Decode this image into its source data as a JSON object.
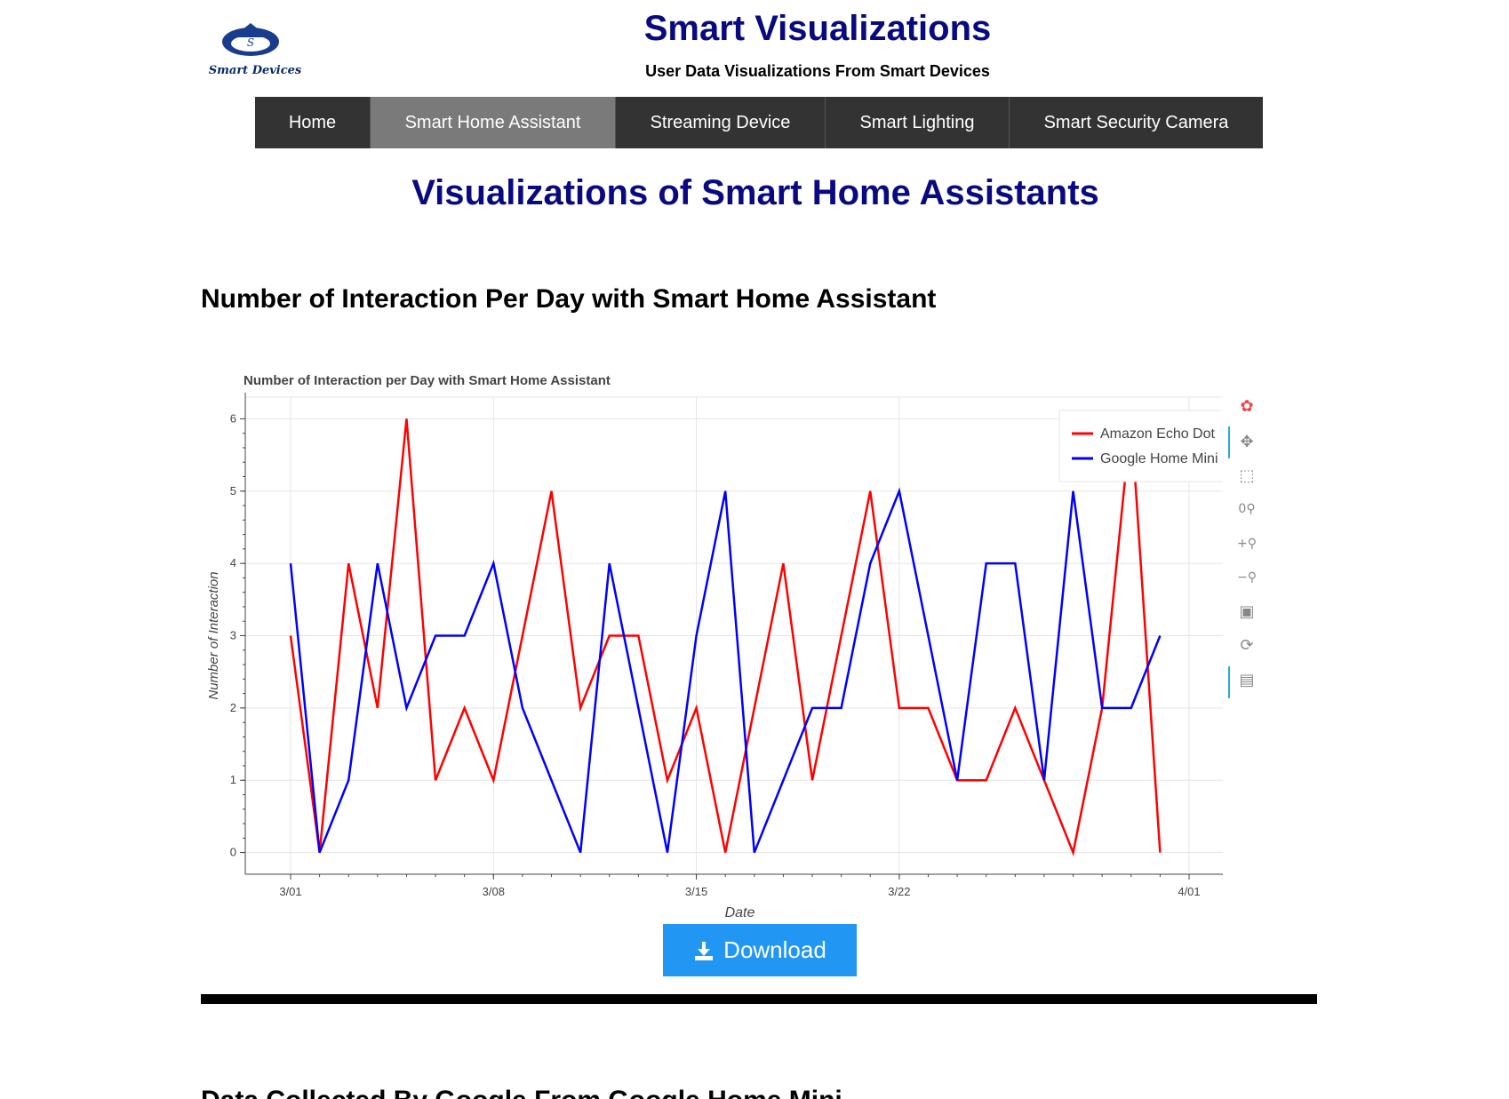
{
  "logo": {
    "text": "Smart Devices"
  },
  "header": {
    "title": "Smart Visualizations",
    "subtitle": "User Data Visualizations From Smart Devices"
  },
  "nav": {
    "items": [
      {
        "label": "Home"
      },
      {
        "label": "Smart Home Assistant"
      },
      {
        "label": "Streaming Device"
      },
      {
        "label": "Smart Lighting"
      },
      {
        "label": "Smart Security Camera"
      }
    ],
    "active": "Smart Home Assistant"
  },
  "page": {
    "heading": "Visualizations of Smart Home Assistants"
  },
  "section1": {
    "heading": "Number of Interaction Per Day with Smart Home Assistant"
  },
  "section2": {
    "heading": "Data Collected By Google From Google Home Mini"
  },
  "download": {
    "label": "Download"
  },
  "toolbar": {
    "icons": [
      "bokeh-logo-icon",
      "pan-icon",
      "box-zoom-icon",
      "wheel-zoom-icon",
      "zoom-in-icon",
      "zoom-out-icon",
      "save-icon",
      "reset-icon",
      "hover-icon"
    ]
  },
  "chart_data": {
    "type": "line",
    "title": "Number of Interaction per Day with Smart Home Assistant",
    "xlabel": "Date",
    "ylabel": "Number of Interaction",
    "x_ticks": [
      "3/01",
      "3/08",
      "3/15",
      "3/22",
      "4/01"
    ],
    "y_ticks": [
      0,
      1,
      2,
      3,
      4,
      5,
      6
    ],
    "ylim": [
      -0.3,
      6.3
    ],
    "grid": true,
    "legend_position": "top-right",
    "x": [
      "3/01",
      "3/02",
      "3/03",
      "3/04",
      "3/05",
      "3/06",
      "3/07",
      "3/08",
      "3/09",
      "3/10",
      "3/11",
      "3/12",
      "3/13",
      "3/14",
      "3/15",
      "3/16",
      "3/17",
      "3/18",
      "3/19",
      "3/20",
      "3/21",
      "3/22",
      "3/23",
      "3/24",
      "3/25",
      "3/26",
      "3/27",
      "3/28",
      "3/29",
      "3/30",
      "3/31"
    ],
    "series": [
      {
        "name": "Amazon Echo Dot",
        "color": "#ff0000",
        "values": [
          3,
          0,
          4,
          2,
          6,
          1,
          2,
          1,
          3,
          5,
          2,
          3,
          3,
          1,
          2,
          0,
          2,
          4,
          1,
          3,
          5,
          2,
          2,
          1,
          1,
          2,
          1,
          0,
          2,
          6,
          0
        ]
      },
      {
        "name": "Google Home Mini",
        "color": "#0000ff",
        "values": [
          4,
          0,
          1,
          4,
          2,
          3,
          3,
          4,
          2,
          1,
          0,
          4,
          2,
          0,
          3,
          5,
          0,
          1,
          2,
          2,
          4,
          5,
          3,
          1,
          4,
          4,
          1,
          5,
          2,
          2,
          3
        ]
      }
    ]
  }
}
